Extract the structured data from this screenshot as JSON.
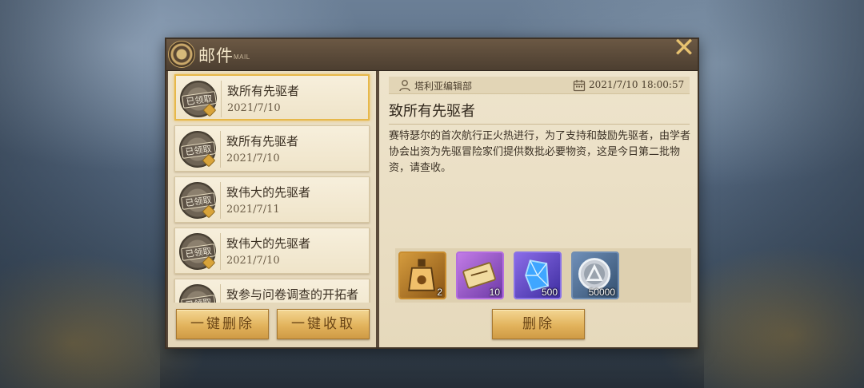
{
  "window": {
    "title": "邮件",
    "subtitle": "MAIL"
  },
  "mail_list": [
    {
      "title": "致所有先驱者",
      "date": "2021/7/10",
      "status": "已领取",
      "selected": true
    },
    {
      "title": "致所有先驱者",
      "date": "2021/7/10",
      "status": "已领取",
      "selected": false
    },
    {
      "title": "致伟大的先驱者",
      "date": "2021/7/11",
      "status": "已领取",
      "selected": false
    },
    {
      "title": "致伟大的先驱者",
      "date": "2021/7/10",
      "status": "已领取",
      "selected": false
    },
    {
      "title": "致参与问卷调查的开拓者",
      "date": "",
      "status": "已领取",
      "selected": false
    }
  ],
  "left_actions": {
    "delete_all": "一键删除",
    "claim_all": "一键收取"
  },
  "detail": {
    "sender": "塔利亚编辑部",
    "timestamp": "2021/7/10 18:00:57",
    "heading": "致所有先驱者",
    "body": "赛特瑟尔的首次航行正火热进行，为了支持和鼓励先驱者，由学者协会出资为先驱冒险家们提供数批必要物资，这是今日第二批物资，请查收。",
    "rewards": [
      {
        "icon": "potion-bottle-icon",
        "count": "2"
      },
      {
        "icon": "scroll-ticket-icon",
        "count": "10"
      },
      {
        "icon": "blue-crystal-icon",
        "count": "500"
      },
      {
        "icon": "silver-coin-icon",
        "count": "50000"
      }
    ],
    "delete_label": "删除"
  },
  "colors": {
    "accent_gold": "#e2b35c",
    "close_icon": "#e7c270",
    "panel_bg": "#eee4cc"
  }
}
